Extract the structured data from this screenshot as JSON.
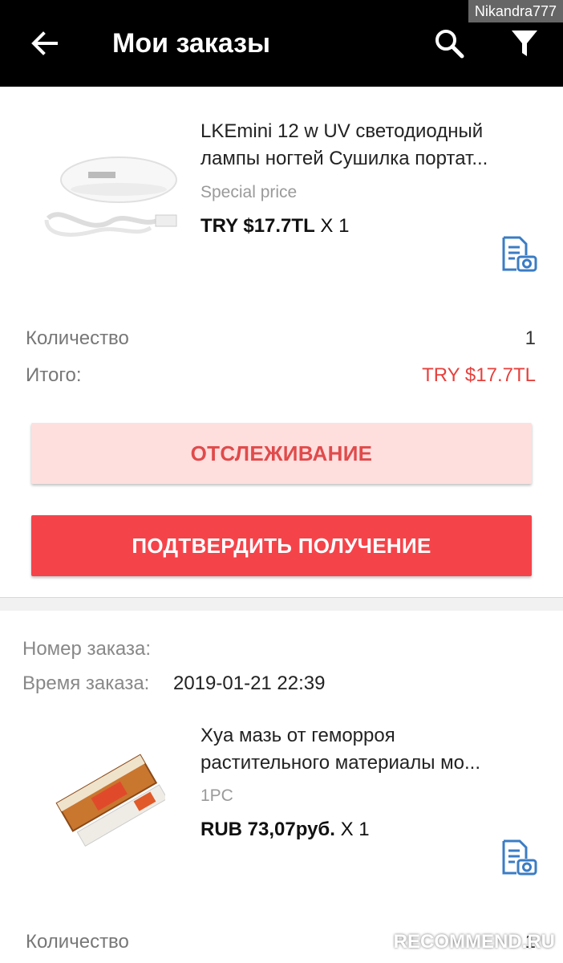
{
  "header": {
    "title": "Мои заказы",
    "username_overlay": "Nikandra777"
  },
  "orders": [
    {
      "product_title_line1": "LKEmini 12 w UV светодиодный",
      "product_title_line2": "лампы ногтей Сушилка портат...",
      "product_subtitle": "Special price",
      "price": "TRY $17.7TL",
      "qty_text": "X 1",
      "quantity_label": "Количество",
      "quantity_value": "1",
      "total_label": "Итого:",
      "total_value": "TRY $17.7TL",
      "track_button": "ОТСЛЕЖИВАНИЕ",
      "confirm_button": "ПОДТВЕРДИТЬ ПОЛУЧЕНИЕ"
    },
    {
      "order_number_label": "Номер заказа:",
      "order_time_label": "Время заказа:",
      "order_time_value": "2019-01-21 22:39",
      "product_title_line1": "Xya мазь от геморроя",
      "product_title_line2": "растительного материалы мо...",
      "product_subtitle": "1PC",
      "price": "RUB 73,07руб.",
      "qty_text": "X 1",
      "quantity_label": "Количество",
      "quantity_value": "1"
    }
  ],
  "watermark": "RECOMMEND.RU",
  "colors": {
    "topbar": "#000000",
    "accent_red": "#f5434a",
    "track_bg": "#ffdede",
    "icon_blue": "#3b7cc4"
  },
  "icons": [
    "back-arrow-icon",
    "search-icon",
    "filter-icon",
    "document-camera-icon"
  ]
}
